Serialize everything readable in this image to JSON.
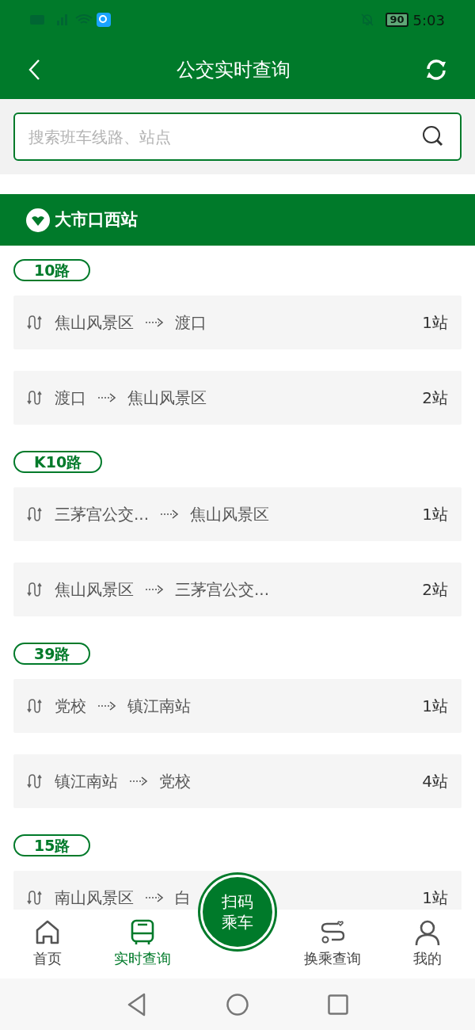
{
  "status_bar": {
    "battery": "90",
    "time": "5:03"
  },
  "header": {
    "title": "公交实时查询"
  },
  "search": {
    "placeholder": "搜索班车线路、站点"
  },
  "station": {
    "name": "大市口西站"
  },
  "routes": [
    {
      "line": "10路",
      "trips": [
        {
          "from": "焦山风景区",
          "to": "渡口",
          "stops": "1站"
        },
        {
          "from": "渡口",
          "to": "焦山风景区",
          "stops": "2站"
        }
      ]
    },
    {
      "line": "K10路",
      "trips": [
        {
          "from": "三茅宫公交...",
          "to": "焦山风景区",
          "stops": "1站"
        },
        {
          "from": "焦山风景区",
          "to": "三茅宫公交...",
          "stops": "2站"
        }
      ]
    },
    {
      "line": "39路",
      "trips": [
        {
          "from": "党校",
          "to": "镇江南站",
          "stops": "1站"
        },
        {
          "from": "镇江南站",
          "to": "党校",
          "stops": "4站"
        }
      ]
    },
    {
      "line": "15路",
      "trips": [
        {
          "from": "南山风景区",
          "to": "白",
          "stops": "1站"
        }
      ]
    }
  ],
  "scan_button": {
    "lines": [
      "扫码",
      "乘车"
    ]
  },
  "tabs": [
    {
      "label": "首页",
      "selected": false
    },
    {
      "label": "实时查询",
      "selected": true
    },
    {
      "label": "换乘查询",
      "selected": false
    },
    {
      "label": "我的",
      "selected": false
    }
  ]
}
